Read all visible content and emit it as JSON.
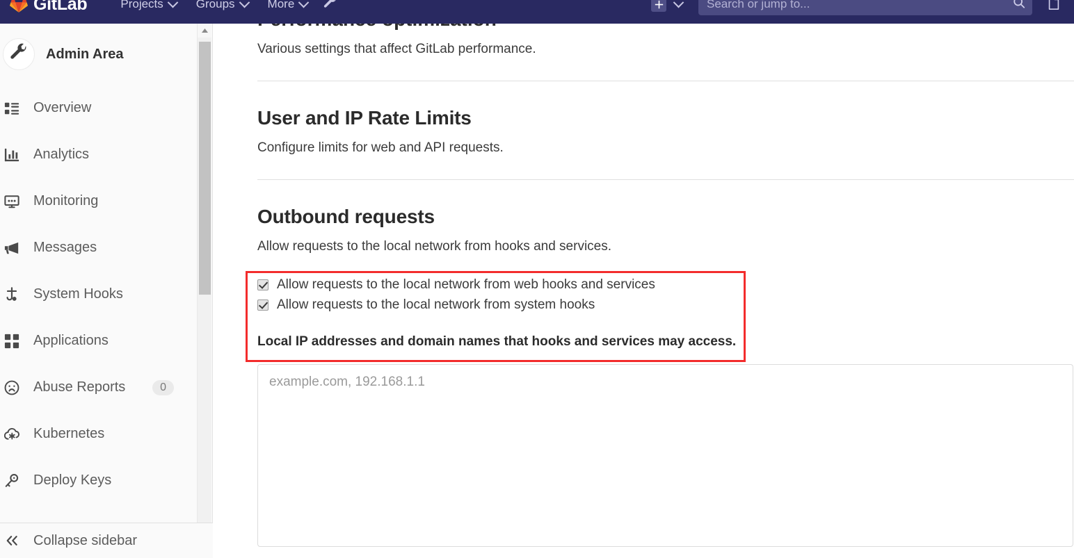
{
  "navbar": {
    "brand": "GitLab",
    "logo_icon": "gitlab-logo-icon",
    "links": [
      {
        "label": "Projects",
        "icon": "chevron-down-icon"
      },
      {
        "label": "Groups",
        "icon": "chevron-down-icon"
      },
      {
        "label": "More",
        "icon": "chevron-down-icon"
      }
    ],
    "admin_icon": "wrench-icon",
    "new_icon": "plus-icon",
    "new_caret_icon": "chevron-down-icon",
    "search": {
      "placeholder": "Search or jump to...",
      "value": "",
      "icon": "search-icon"
    },
    "issues_icon": "issues-document-icon",
    "bg_color": "#292961",
    "search_bg_color": "#4b4b82"
  },
  "sidebar": {
    "title": "Admin Area",
    "avatar_icon": "wrench-icon",
    "items": [
      {
        "label": "Overview",
        "icon": "overview-list-icon",
        "badge": ""
      },
      {
        "label": "Analytics",
        "icon": "chart-bar-icon",
        "badge": ""
      },
      {
        "label": "Monitoring",
        "icon": "monitor-icon",
        "badge": ""
      },
      {
        "label": "Messages",
        "icon": "megaphone-icon",
        "badge": ""
      },
      {
        "label": "System Hooks",
        "icon": "hook-icon",
        "badge": ""
      },
      {
        "label": "Applications",
        "icon": "applications-grid-icon",
        "badge": ""
      },
      {
        "label": "Abuse Reports",
        "icon": "frown-face-icon",
        "badge": "0"
      },
      {
        "label": "Kubernetes",
        "icon": "cloud-gear-icon",
        "badge": ""
      },
      {
        "label": "Deploy Keys",
        "icon": "key-icon",
        "badge": ""
      }
    ],
    "footer": {
      "label": "Collapse sidebar",
      "icon": "double-chevron-left-icon"
    },
    "scrollbar": {
      "up_arrow_icon": "scroll-up-arrow-icon"
    }
  },
  "main": {
    "clipped_heading": "Performance optimization",
    "sections": [
      {
        "title": "",
        "description": "Various settings that affect GitLab performance."
      },
      {
        "title": "User and IP Rate Limits",
        "description": "Configure limits for web and API requests."
      },
      {
        "title": "Outbound requests",
        "description": "Allow requests to the local network from hooks and services."
      }
    ],
    "outbound": {
      "checkboxes": [
        {
          "label": "Allow requests to the local network from web hooks and services",
          "checked": true
        },
        {
          "label": "Allow requests to the local network from system hooks",
          "checked": true
        }
      ],
      "field_label": "Local IP addresses and domain names that hooks and services may access.",
      "textarea": {
        "placeholder": "example.com, 192.168.1.1",
        "value": ""
      }
    },
    "annotation": {
      "name": "red-highlight-box",
      "color": "#f32c2c"
    }
  }
}
